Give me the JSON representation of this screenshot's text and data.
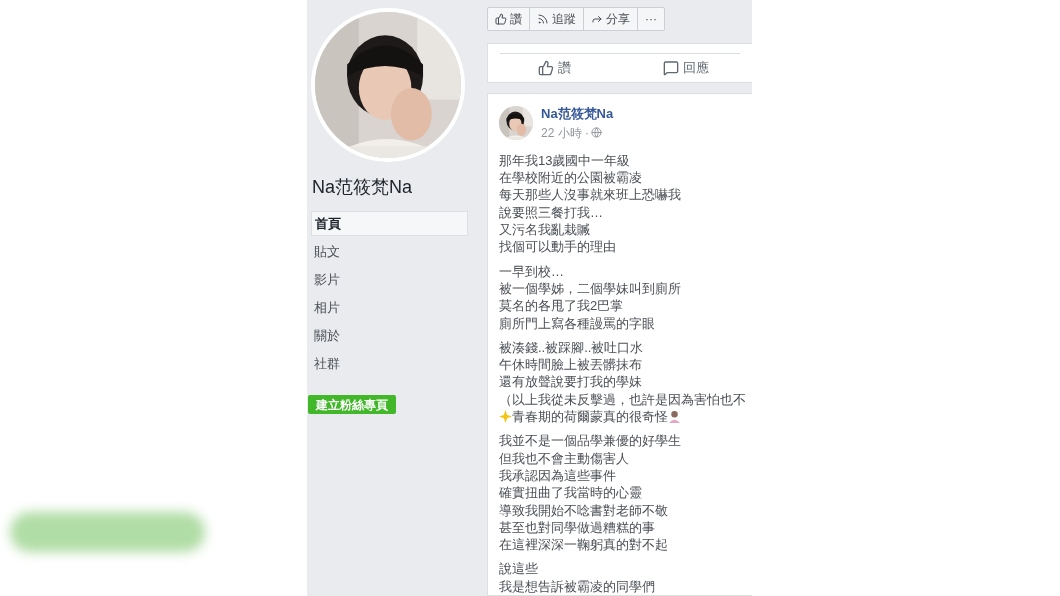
{
  "page": {
    "name": "Na范筱梵Na",
    "nav": [
      {
        "label": "首頁",
        "selected": true
      },
      {
        "label": "貼文",
        "selected": false
      },
      {
        "label": "影片",
        "selected": false
      },
      {
        "label": "相片",
        "selected": false
      },
      {
        "label": "關於",
        "selected": false
      },
      {
        "label": "社群",
        "selected": false
      }
    ],
    "create_button": "建立粉絲專頁"
  },
  "actions": [
    {
      "kind": "like",
      "label": "讚"
    },
    {
      "kind": "follow",
      "label": "追蹤"
    },
    {
      "kind": "share",
      "label": "分享"
    },
    {
      "kind": "more",
      "label": "···"
    }
  ],
  "previous_post": {
    "actions": [
      {
        "kind": "like",
        "label": "讚"
      },
      {
        "kind": "comment",
        "label": "回應"
      }
    ]
  },
  "post": {
    "author": "Na范筱梵Na",
    "time": "22 小時 ·",
    "paragraphs": [
      [
        "那年我13歲國中一年級",
        "在學校附近的公園被霸凌",
        "每天那些人沒事就來班上恐嚇我",
        "說要照三餐打我…",
        "又污名我亂栽贓",
        "找個可以動手的理由"
      ],
      [
        "一早到校…",
        "被一個學姊，二個學妹叫到廁所",
        "莫名的各甩了我2巴掌",
        "廁所門上寫各種謾罵的字眼"
      ],
      [
        "被湊錢..被踩腳..被吐口水",
        "午休時間臉上被丟髒抹布",
        "還有放聲說要打我的學妹",
        "（以上我從未反擊過，也許是因為害怕也不",
        "青春期的荷爾蒙真的很奇怪"
      ],
      [
        "我並不是一個品學兼優的好學生",
        "但我也不會主動傷害人",
        "我承認因為這些事件",
        "確實扭曲了我當時的心靈",
        "導致我開始不唸書對老師不敬",
        "甚至也對同學做過糟糕的事",
        "在這裡深深一鞠躬真的對不起"
      ],
      [
        "說這些",
        "我是想告訴被霸凌的同學們"
      ]
    ]
  }
}
